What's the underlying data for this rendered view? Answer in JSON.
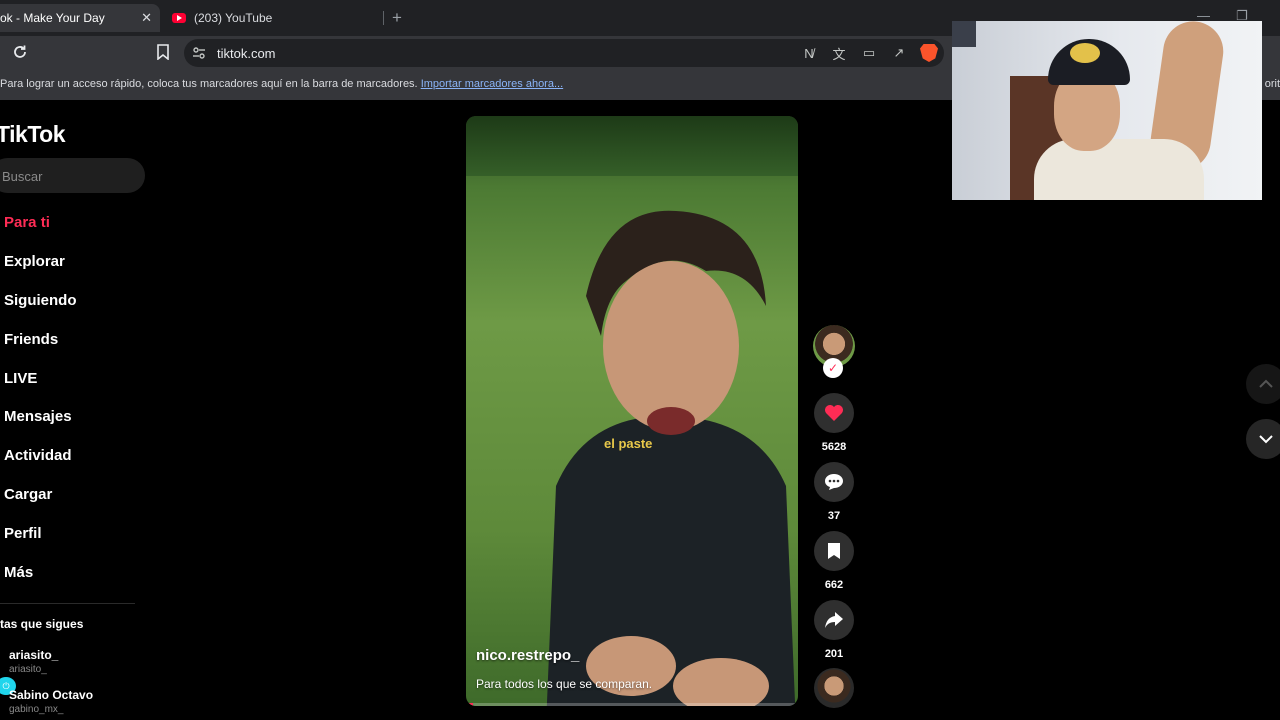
{
  "browser": {
    "active_tab_title": "ok - Make Your Day",
    "other_tab_title": "(203) YouTube",
    "url": "tiktok.com",
    "bookmarks_msg": "Para lograr un acceso rápido, coloca tus marcadores aquí en la barra de marcadores.",
    "bookmarks_link": "Importar marcadores ahora...",
    "bookmarks_right": "orit"
  },
  "tiktok": {
    "logo": "TikTok",
    "search_placeholder": "Buscar",
    "nav": [
      "Para ti",
      "Explorar",
      "Siguiendo",
      "Friends",
      "LIVE",
      "Mensajes",
      "Actividad",
      "Cargar",
      "Perfil",
      "Más"
    ],
    "following_title": "tas que sigues",
    "following": [
      {
        "name": "ariasito_",
        "handle": "ariasito_"
      },
      {
        "name": "Sabino Octavo",
        "handle": "gabino_mx_"
      }
    ]
  },
  "video": {
    "caption": "el paste",
    "username": "nico.restrepo_",
    "description": "Para todos los que se comparan.",
    "progress": 0.02
  },
  "actions": {
    "likes": "5628",
    "comments": "37",
    "saves": "662",
    "shares": "201"
  },
  "colors": {
    "accent": "#fe2c55",
    "background": "#000000"
  }
}
